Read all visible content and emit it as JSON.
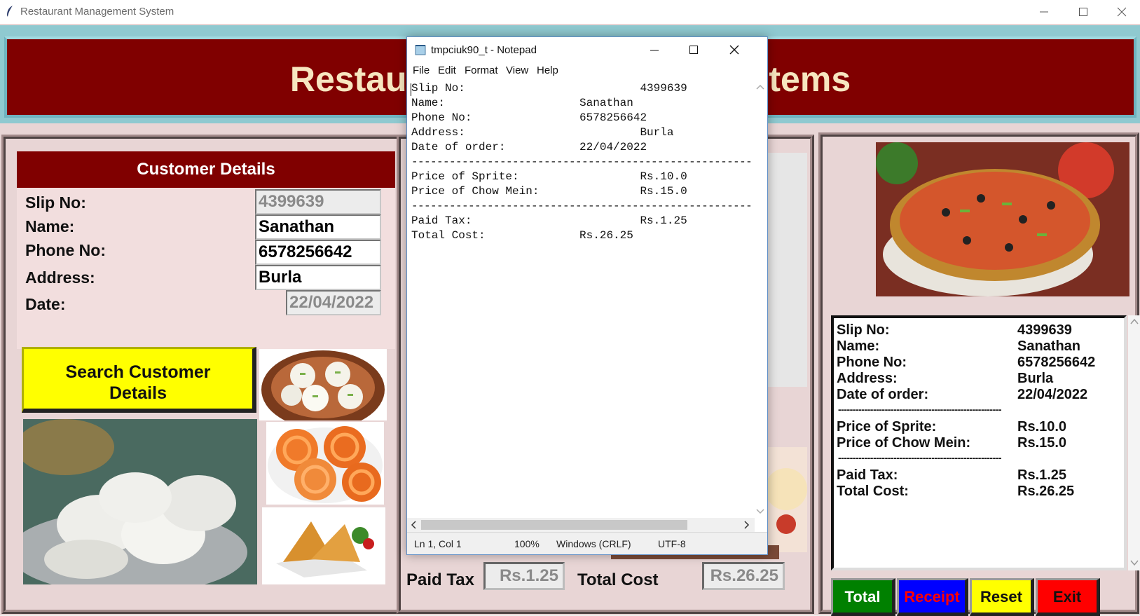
{
  "window": {
    "title": "Restaurant Management System"
  },
  "banner": {
    "title": "Restaurant Management Systems"
  },
  "customer": {
    "header": "Customer Details",
    "labels": {
      "slip": "Slip No:",
      "name": "Name:",
      "phone": "Phone No:",
      "address": "Address:",
      "date": "Date:"
    },
    "values": {
      "slip": "4399639",
      "name": "Sanathan",
      "phone": "6578256642",
      "address": "Burla",
      "date": "22/04/2022"
    }
  },
  "search_button": {
    "line1": "Search Customer",
    "line2": "Details"
  },
  "totals": {
    "tax_label": "Paid Tax",
    "tax_value": "Rs.1.25",
    "cost_label": "Total Cost",
    "cost_value": "Rs.26.25"
  },
  "receipt": {
    "rows": [
      {
        "label": "Slip No:",
        "value": "4399639"
      },
      {
        "label": "Name:",
        "value": "Sanathan"
      },
      {
        "label": "Phone No:",
        "value": "6578256642"
      },
      {
        "label": "Address:",
        "value": "Burla"
      },
      {
        "label": "Date of order:",
        "value": "22/04/2022"
      }
    ],
    "dash_line": "--------------------------------------------------------",
    "items": [
      {
        "label": "Price of Sprite:",
        "value": "Rs.10.0"
      },
      {
        "label": "Price of Chow Mein:",
        "value": "Rs.15.0"
      }
    ],
    "summary": [
      {
        "label": "Paid Tax:",
        "value": "Rs.1.25"
      },
      {
        "label": "Total Cost:",
        "value": "Rs.26.25"
      }
    ]
  },
  "action_buttons": {
    "total": "Total",
    "receipt": "Receipt",
    "reset": "Reset",
    "exit": "Exit"
  },
  "colors": {
    "banner": "#800000",
    "total": "#008000",
    "receipt": "#0000ff",
    "reset": "#ffff00",
    "exit": "#ff0000"
  },
  "notepad": {
    "title": "tmpciuk90_t - Notepad",
    "menu": [
      "File",
      "Edit",
      "Format",
      "View",
      "Help"
    ],
    "lines": [
      "Slip No:                          4399639",
      "Name:                    Sanathan",
      "Phone No:                6578256642",
      "Address:                          Burla",
      "Date of order:           22/04/2022",
      "-------------------------------------------------------",
      "Price of Sprite:                  Rs.10.0",
      "Price of Chow Mein:               Rs.15.0",
      "-------------------------------------------------------",
      "Paid Tax:                         Rs.1.25",
      "Total Cost:              Rs.26.25"
    ],
    "status": {
      "position": "Ln 1, Col 1",
      "zoom": "100%",
      "line_ending": "Windows (CRLF)",
      "encoding": "UTF-8"
    }
  }
}
